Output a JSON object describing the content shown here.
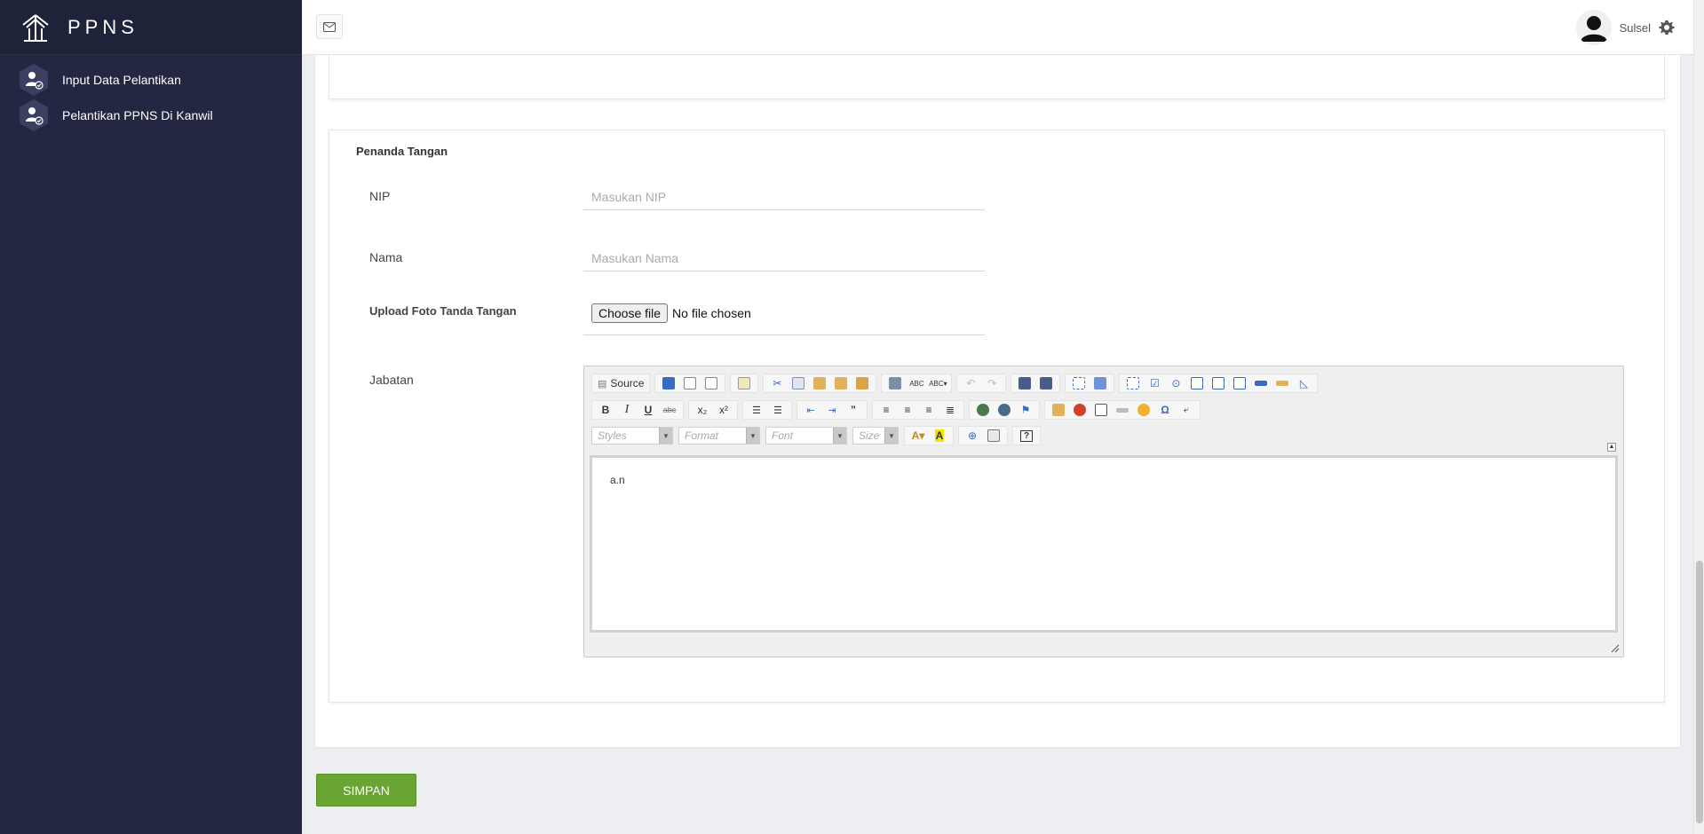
{
  "app": {
    "brand": "PPNS"
  },
  "sidebar": {
    "items": [
      {
        "label": "Input Data Pelantikan",
        "icon": "user-check-icon"
      },
      {
        "label": "Pelantikan PPNS Di Kanwil",
        "icon": "user-check-icon"
      }
    ]
  },
  "topbar": {
    "user_name": "Sulsel"
  },
  "form": {
    "section_title": "Penanda Tangan",
    "nip": {
      "label": "NIP",
      "placeholder": "Masukan NIP",
      "value": ""
    },
    "nama": {
      "label": "Nama",
      "placeholder": "Masukan Nama",
      "value": ""
    },
    "upload": {
      "label": "Upload Foto Tanda Tangan",
      "button": "Choose file",
      "status": "No file chosen"
    },
    "jabatan": {
      "label": "Jabatan",
      "content": "a.n"
    },
    "submit_label": "SIMPAN"
  },
  "editor": {
    "source_label": "Source",
    "combos": {
      "styles": "Styles",
      "format": "Format",
      "font": "Font",
      "size": "Size"
    },
    "format_buttons": {
      "bold": "B",
      "italic": "I",
      "underline": "U",
      "strike": "abc",
      "subscript": "x₂",
      "superscript": "x²",
      "special_char": "Ω"
    }
  },
  "colors": {
    "sidebar_bg": "#232741",
    "submit_bg": "#6aa534",
    "page_bg": "#edeef2"
  }
}
